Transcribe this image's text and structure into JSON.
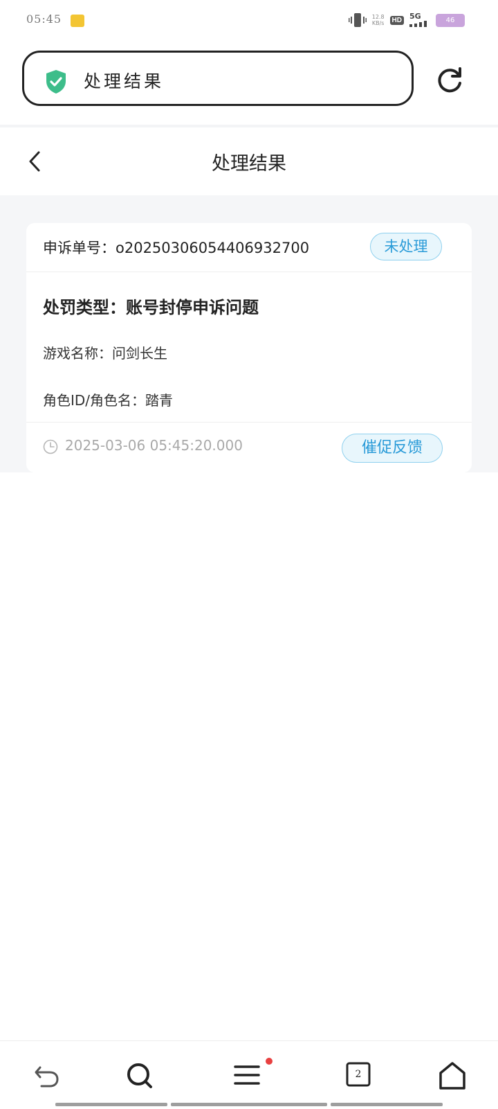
{
  "status_bar": {
    "time": "05:45",
    "net_speed_value": "12.8",
    "net_speed_unit": "KB/s",
    "hd": "HD",
    "network": "5G",
    "battery": "46"
  },
  "browser": {
    "address_text": "处理结果",
    "tab_count": "2"
  },
  "header": {
    "title": "处理结果"
  },
  "card": {
    "appeal_no": "申诉单号：o20250306054406932700",
    "status": "未处理",
    "penalty_type": "处罚类型：账号封停申诉问题",
    "game_name": "游戏名称：问剑长生",
    "role_info": "角色ID/角色名：踏青",
    "timestamp": "2025-03-06 05:45:20.000",
    "urge_label": "催促反馈"
  },
  "colors": {
    "accent": "#2a9bd8",
    "shield": "#3dbd8a",
    "page_bg": "#f5f6f8",
    "notification_dot": "#e84040"
  }
}
